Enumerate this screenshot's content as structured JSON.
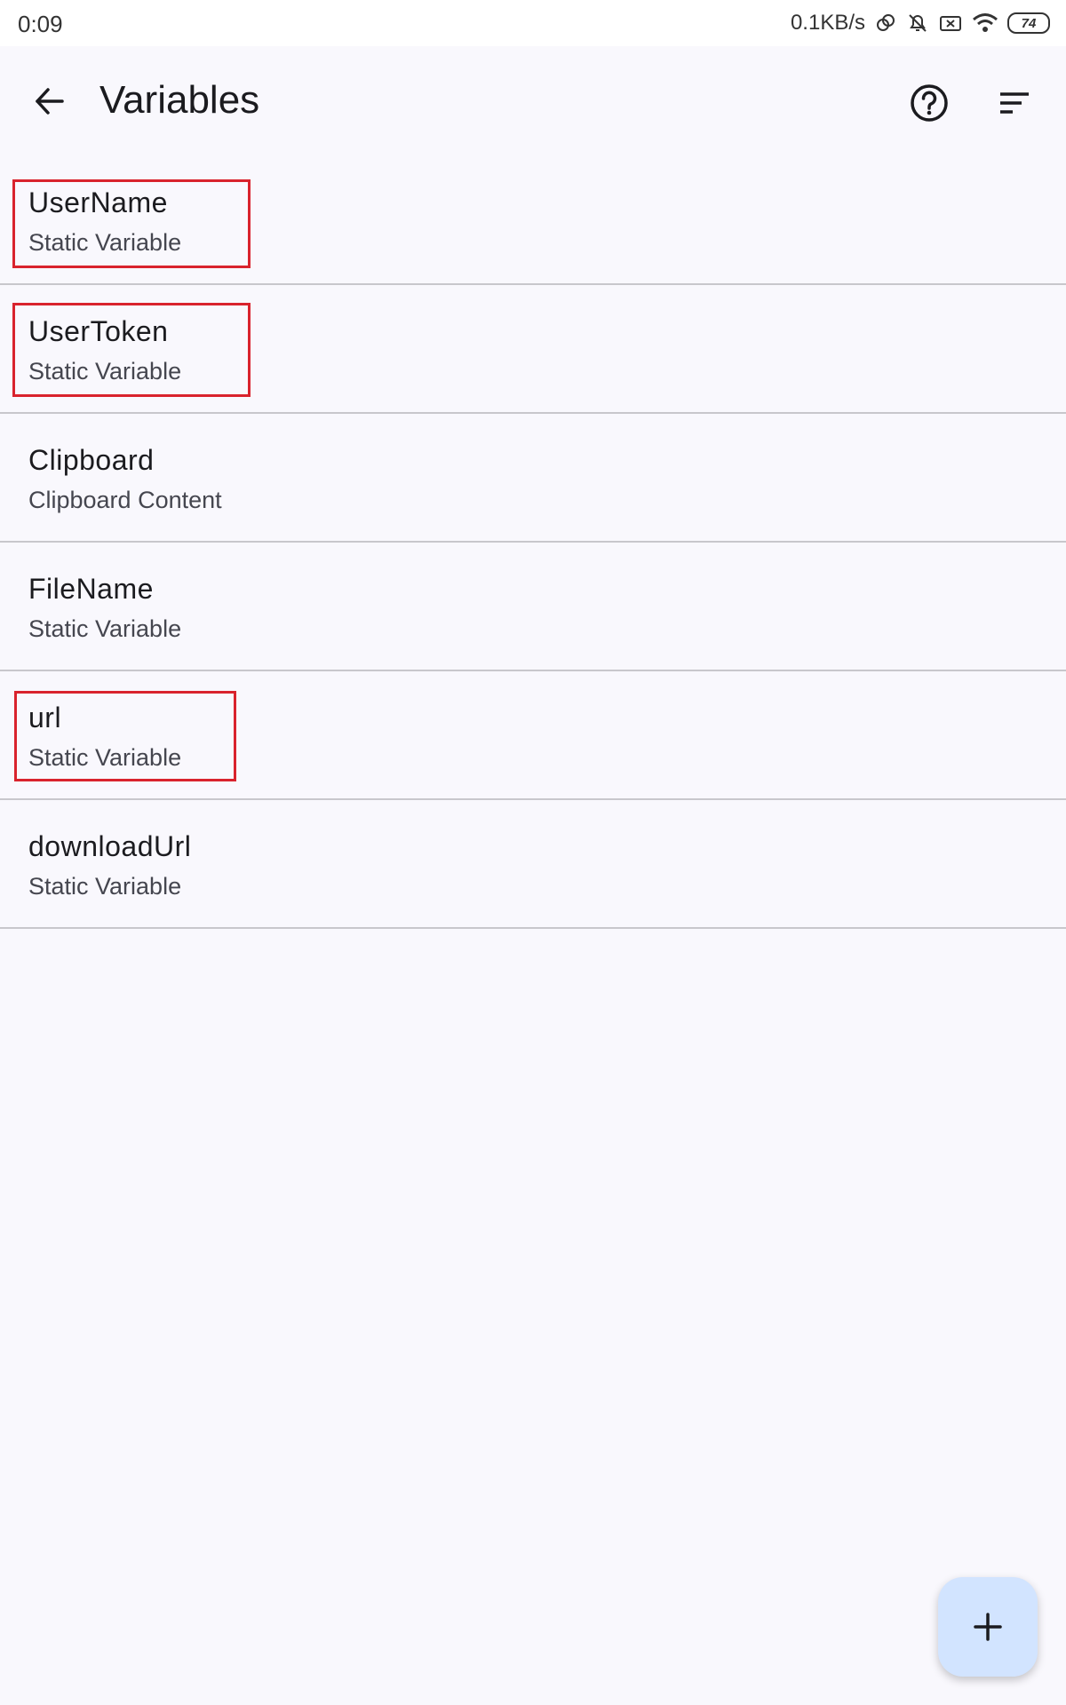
{
  "status_bar": {
    "time": "0:09",
    "net_speed": "0.1KB/s",
    "battery": "74"
  },
  "header": {
    "title": "Variables",
    "back_icon": "arrow-left-icon",
    "help_icon": "help-circle-icon",
    "sort_icon": "sort-icon"
  },
  "variables": [
    {
      "name": "UserName",
      "type": "Static Variable",
      "highlighted": true
    },
    {
      "name": "UserToken",
      "type": "Static Variable",
      "highlighted": true
    },
    {
      "name": "Clipboard",
      "type": "Clipboard Content",
      "highlighted": false
    },
    {
      "name": "FileName",
      "type": "Static Variable",
      "highlighted": false
    },
    {
      "name": "url",
      "type": "Static Variable",
      "highlighted": true
    },
    {
      "name": "downloadUrl",
      "type": "Static Variable",
      "highlighted": false
    }
  ],
  "fab": {
    "icon": "plus-icon"
  },
  "colors": {
    "background": "#f9f8fd",
    "divider": "#c8c7cc",
    "highlight_border": "#d9232d",
    "fab": "#d2e4ff"
  }
}
